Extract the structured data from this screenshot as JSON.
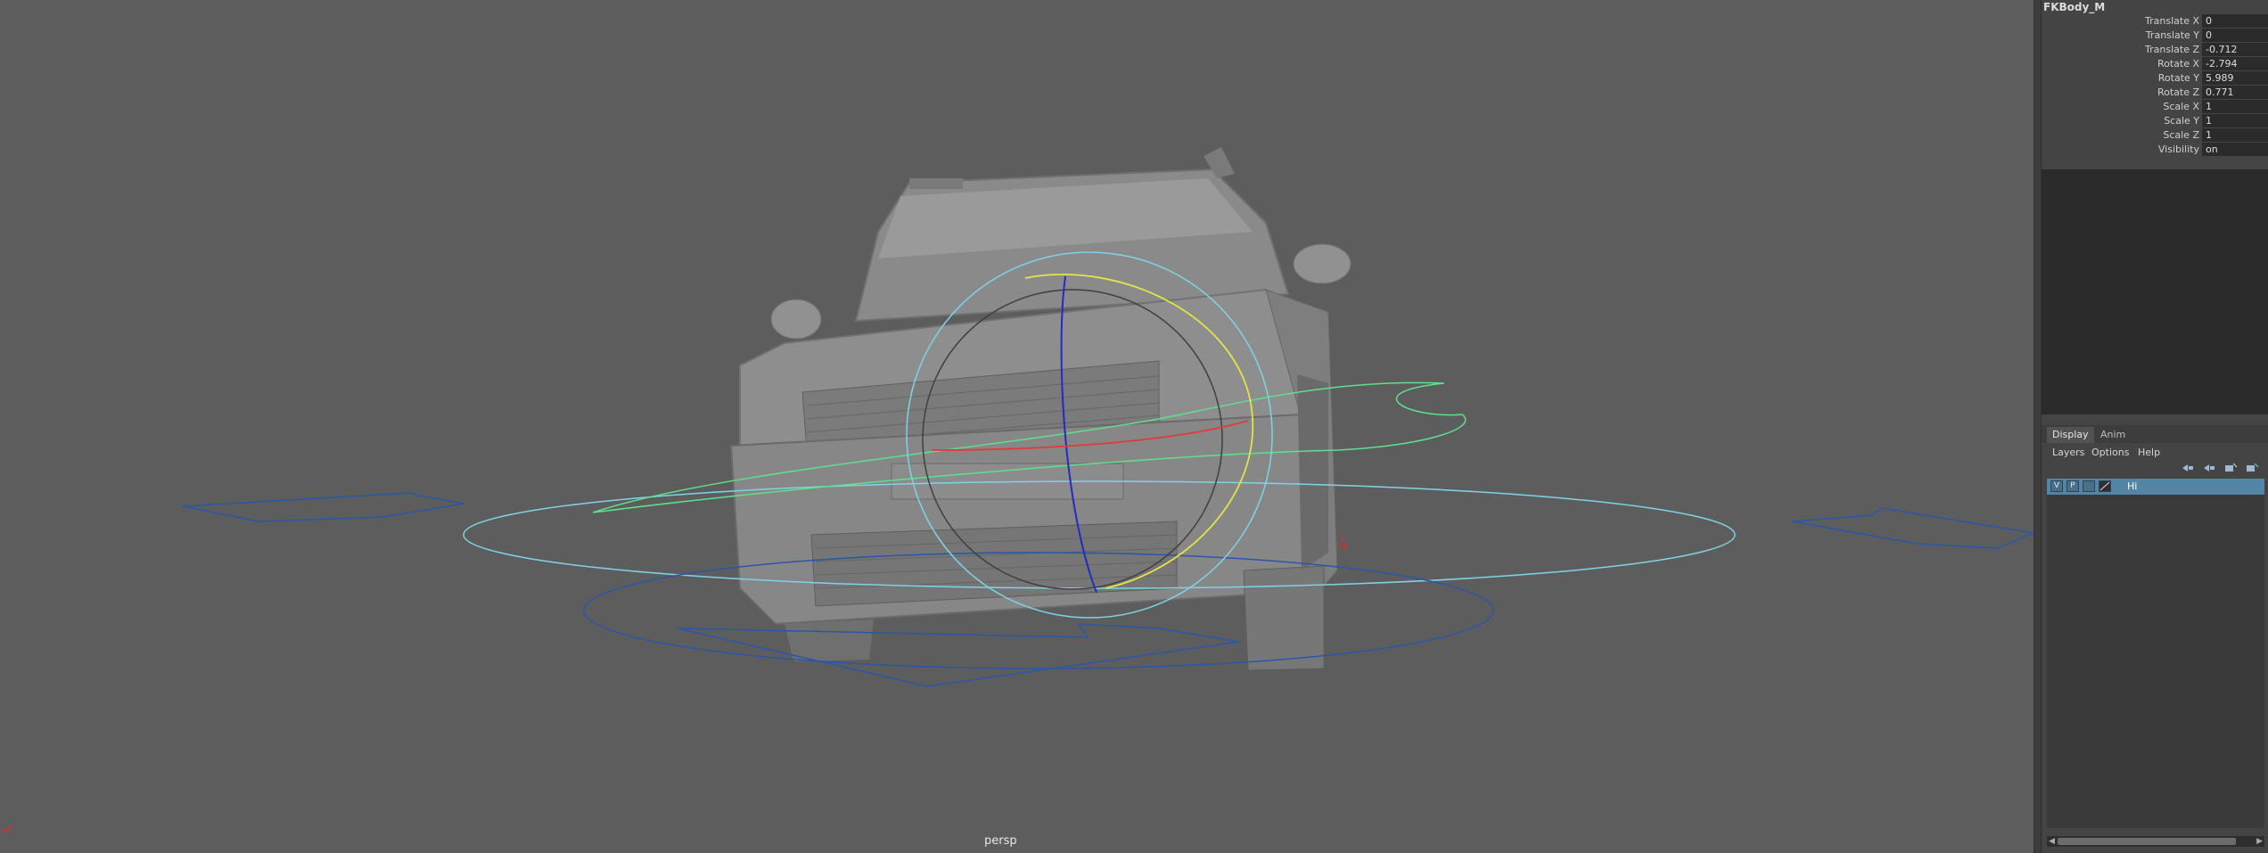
{
  "viewport": {
    "camera_label": "persp"
  },
  "channel_box": {
    "node_name": "FKBody_M",
    "attributes": [
      {
        "label": "Translate X",
        "value": "0"
      },
      {
        "label": "Translate Y",
        "value": "0"
      },
      {
        "label": "Translate Z",
        "value": "-0.712"
      },
      {
        "label": "Rotate X",
        "value": "-2.794"
      },
      {
        "label": "Rotate Y",
        "value": "5.989"
      },
      {
        "label": "Rotate Z",
        "value": "0.771"
      },
      {
        "label": "Scale X",
        "value": "1"
      },
      {
        "label": "Scale Y",
        "value": "1"
      },
      {
        "label": "Scale Z",
        "value": "1"
      },
      {
        "label": "Visibility",
        "value": "on"
      }
    ]
  },
  "layer_editor": {
    "tabs": [
      "Display",
      "Anim"
    ],
    "active_tab": "Display",
    "menu": [
      "Layers",
      "Options",
      "Help"
    ],
    "layers": [
      {
        "visible": "V",
        "playback": "P",
        "name": "Hi"
      }
    ]
  },
  "colors": {
    "viewport_bg": "#5d5d5d",
    "panel_bg": "#444444",
    "selected_layer": "#5285a6",
    "control_cyan": "#7fd3e6",
    "control_blue": "#2a56a8",
    "control_yellow": "#e6e24a",
    "control_green": "#5fe08a"
  }
}
